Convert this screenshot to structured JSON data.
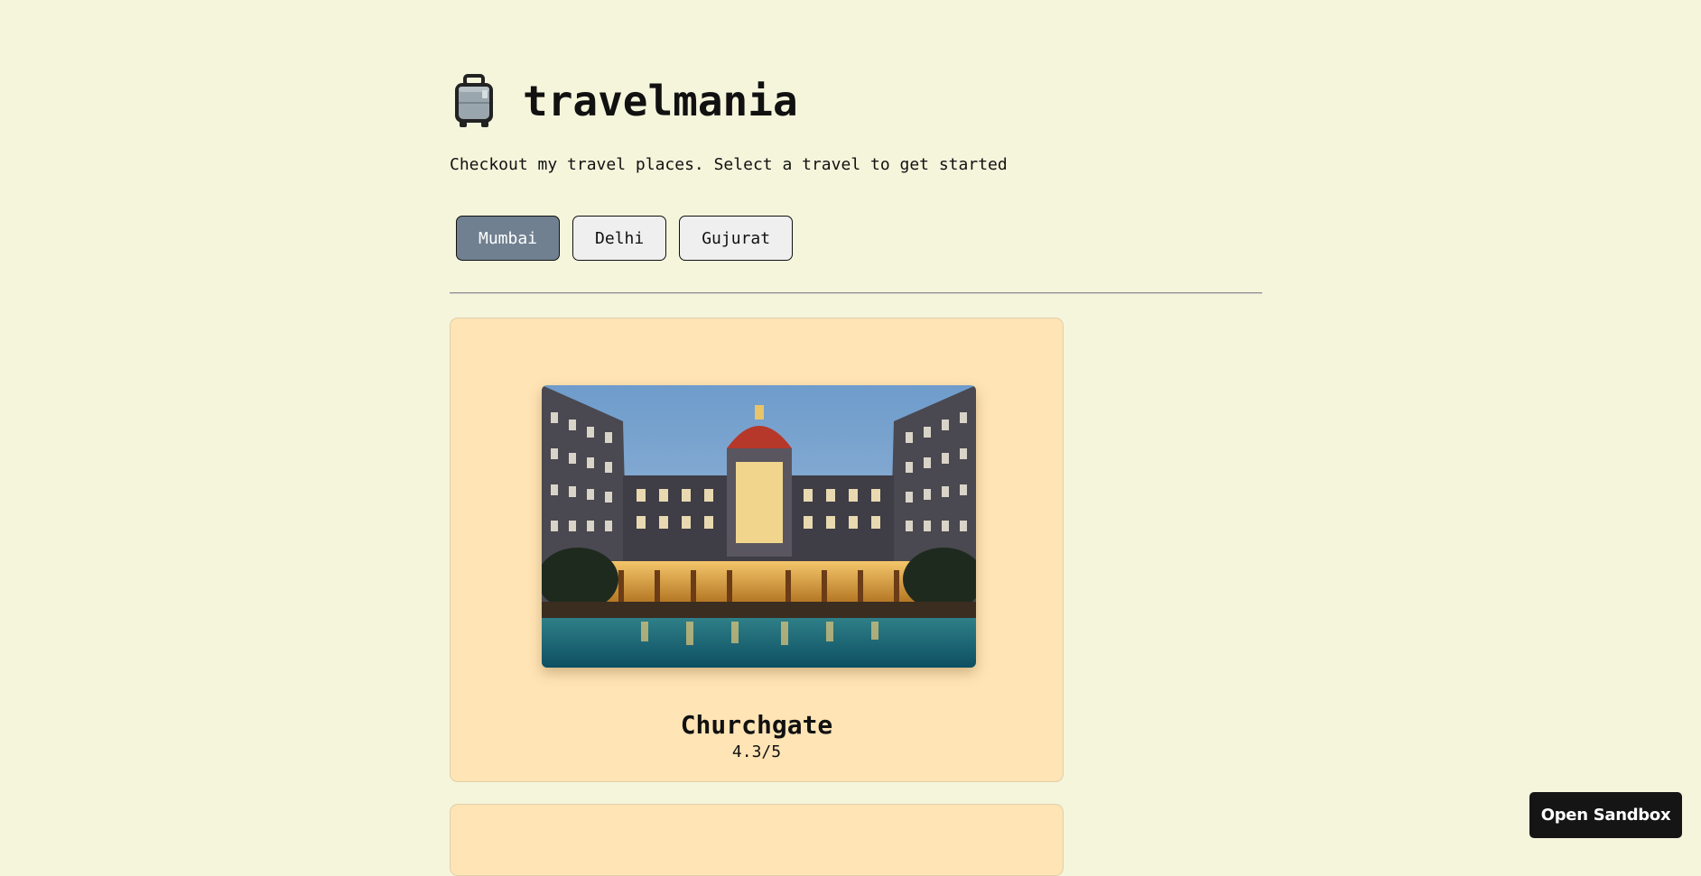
{
  "app": {
    "title": "travelmania",
    "logo_icon": "luggage-icon",
    "subtitle": "Checkout my travel places. Select a travel to get started"
  },
  "tabs": [
    {
      "label": "Mumbai",
      "active": true
    },
    {
      "label": "Delhi",
      "active": false
    },
    {
      "label": "Gujurat",
      "active": false
    }
  ],
  "places": [
    {
      "name": "Churchgate",
      "rating": "4.3/5"
    }
  ],
  "sandbox": {
    "label": "Open Sandbox"
  },
  "colors": {
    "background": "#f5f5dc",
    "card": "#ffe4b5",
    "active_tab": "#708090",
    "tab": "#efefef",
    "sandbox_button": "#151515"
  }
}
